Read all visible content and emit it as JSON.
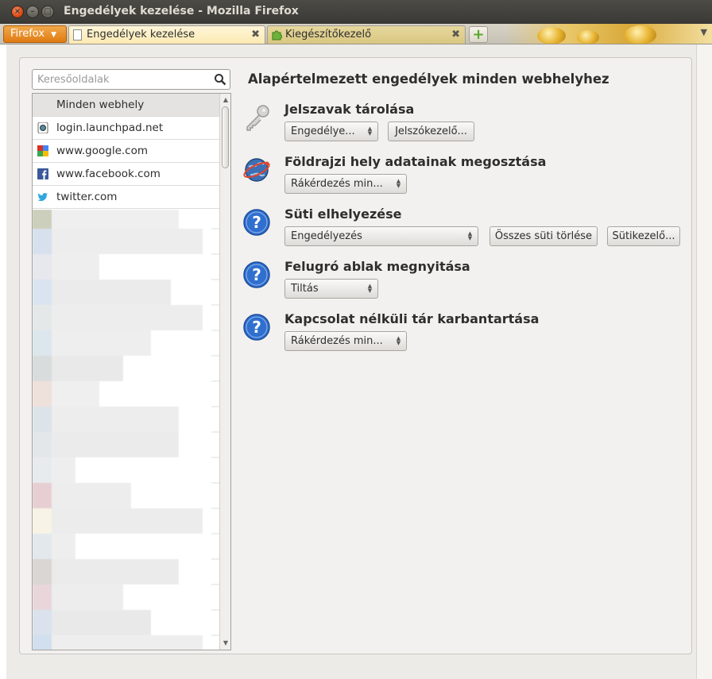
{
  "window": {
    "title": "Engedélyek kezelése - Mozilla Firefox"
  },
  "tabs": {
    "firefox_menu": "Firefox",
    "items": [
      {
        "label": "Engedélyek kezelése",
        "active": true
      },
      {
        "label": "Kiegészítőkezelő",
        "active": false
      }
    ]
  },
  "search": {
    "placeholder": "Keresőoldalak",
    "value": ""
  },
  "sites": [
    {
      "label": "Minden webhely",
      "icon": "none",
      "selected": true
    },
    {
      "label": "login.launchpad.net",
      "icon": "launchpad-icon"
    },
    {
      "label": "www.google.com",
      "icon": "google-icon"
    },
    {
      "label": "www.facebook.com",
      "icon": "facebook-icon"
    },
    {
      "label": "twitter.com",
      "icon": "twitter-icon"
    }
  ],
  "main": {
    "title": "Alapértelmezett engedélyek minden webhelyhez",
    "permissions": [
      {
        "title": "Jelszavak tárolása",
        "icon": "key-icon",
        "select": "Engedélye...",
        "buttons": [
          "Jelszókezelő..."
        ]
      },
      {
        "title": "Földrajzi hely adatainak megosztása",
        "icon": "globe-location-icon",
        "select": "Rákérdezés min...",
        "buttons": []
      },
      {
        "title": "Süti elhelyezése",
        "icon": "question-icon",
        "select": "Engedélyezés",
        "buttons": [
          "Összes süti törlése",
          "Sütikezelő..."
        ]
      },
      {
        "title": "Felugró ablak megnyitása",
        "icon": "question-icon",
        "select": "Tiltás",
        "buttons": []
      },
      {
        "title": "Kapcsolat nélküli tár karbantartása",
        "icon": "question-icon",
        "select": "Rákérdezés min...",
        "buttons": []
      }
    ]
  }
}
